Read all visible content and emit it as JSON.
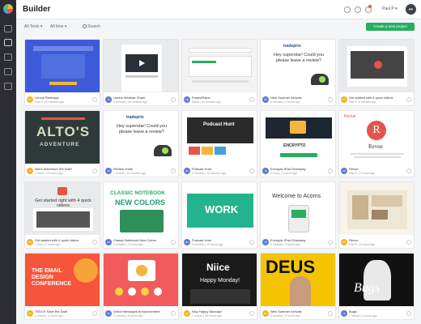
{
  "app": {
    "title": "Builder"
  },
  "user": {
    "name": "Paul P",
    "initials": "PP"
  },
  "filters": {
    "tests": "All Tests",
    "time": "All time",
    "search_placeholder": "Search"
  },
  "create_button": "Create a new project",
  "icons": [
    "settings-icon",
    "user-icon",
    "bell-icon"
  ],
  "colors": {
    "accent": "#27ae60",
    "sidebar": "#2b2d33",
    "notification": "#e5544b"
  },
  "cards": [
    {
      "name": "Litmus Redesign",
      "time": "Paul P. 20 minutes ago",
      "avatar": "PP",
      "avatar_color": "#f0b429"
    },
    {
      "name": "Litmus Webinar Share",
      "time": "2 minutes | 20 minutes ago",
      "avatar": "JK",
      "avatar_color": "#5b7bd5"
    },
    {
      "name": "ProjectPalus",
      "time": "Name | 60 minutes ago",
      "avatar": "AB",
      "avatar_color": "#5b7bd5"
    },
    {
      "name": "New Summer Arrivals",
      "time": "4 minutes | 2 hours ago",
      "avatar": "MK",
      "avatar_color": "#5b7bd5"
    },
    {
      "name": "Get started with 4 quick videos",
      "time": "Paul P. 4 minutes ago",
      "avatar": "PP",
      "avatar_color": "#f0b429"
    },
    {
      "name": "Alto's Adventure 5% Sale!",
      "time": "3 hours | 15 hours ago",
      "avatar": "JK",
      "avatar_color": "#f0b429"
    },
    {
      "name": "Review email",
      "time": "1 minute | 14 minutes ago",
      "avatar": "AB",
      "avatar_color": "#5b7bd5"
    },
    {
      "name": "Podcast Hunt",
      "time": "4 minutes | 16 minutes ago",
      "avatar": "MK",
      "avatar_color": "#5b7bd5"
    },
    {
      "name": "Encrypto iPad Giveaway",
      "time": "4 hours | 2 hours ago",
      "avatar": "JK",
      "avatar_color": "#5b7bd5"
    },
    {
      "name": "Revue",
      "time": "Paul P. | 2 hours ago",
      "avatar": "PP",
      "avatar_color": "#5b7bd5"
    },
    {
      "name": "Get started with 4 quick videos",
      "time": "1 hour | 4 hours ago",
      "avatar": "PP",
      "avatar_color": "#f0b429"
    },
    {
      "name": "Classic Notebook New Colors",
      "time": "4 minutes | 3 hours ago",
      "avatar": "AB",
      "avatar_color": "#5b7bd5"
    },
    {
      "name": "Podcast Hunt",
      "time": "4 minutes | 15 hours ago",
      "avatar": "MK",
      "avatar_color": "#5b7bd5"
    },
    {
      "name": "Encrypto iPad Giveaway",
      "time": "4 minutes | 5 hours ago",
      "avatar": "JK",
      "avatar_color": "#5b7bd5"
    },
    {
      "name": "Revue",
      "time": "Paul P. | 4 hours ago",
      "avatar": "PP",
      "avatar_color": "#f0b429"
    },
    {
      "name": "TEDCK Save the Date",
      "time": "1 minute | 4 hours ago",
      "avatar": "PP",
      "avatar_color": "#f0b429"
    },
    {
      "name": "Direct Messages Announcement",
      "time": "2 minutes | 8 hours ago",
      "avatar": "JK",
      "avatar_color": "#5b7bd5"
    },
    {
      "name": "Nicy Happy Monday!",
      "time": "1 minute | 15 hours ago",
      "avatar": "AB",
      "avatar_color": "#f0b429"
    },
    {
      "name": "New Summer Arrivals",
      "time": "4 minutes | 3 hours ago",
      "avatar": "MK",
      "avatar_color": "#f0b429"
    },
    {
      "name": "Bugs!",
      "time": "1 minute | 4 hours ago",
      "avatar": "JK",
      "avatar_color": "#5b7bd5"
    }
  ],
  "thumbnails": {
    "review_text": "Hey superstar! Could you please leave a review?",
    "brand_tradeprio": "tradeprio",
    "alto_title": "ALTO'S",
    "alto_sub": "ADVENTURE",
    "podcast_title": "Podcast Hunt",
    "encrypto": "ENCRYPTO",
    "revue_logo": "R",
    "revue_name": "Revue",
    "get_started": "Get started right with 4 quick videos",
    "classic": "CLASSIC NOTEBOOK",
    "new_colors": "NEW COLORS",
    "work": "WORK",
    "acorns": "Welcome to Acorns",
    "email_design": "THE EMAIL DESIGN CONFERENCE",
    "nice": "Niice",
    "happy_monday": "Happy Monday!",
    "deus": "DEUS",
    "bugs": "Bugs"
  }
}
